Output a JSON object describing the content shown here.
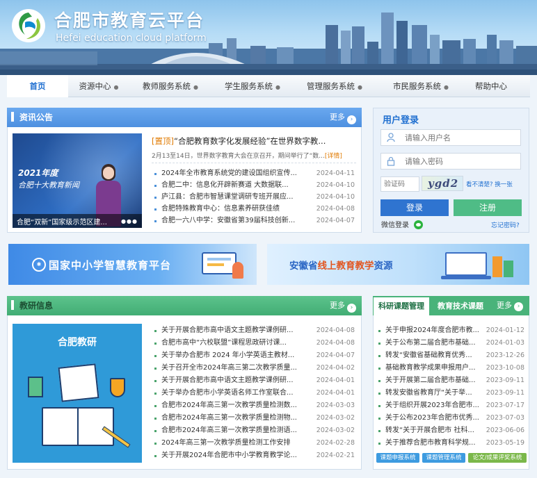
{
  "header": {
    "title": "合肥市教育云平台",
    "subtitle": "Hefei education cloud platform"
  },
  "nav": {
    "items": [
      {
        "label": "首页",
        "active": true,
        "dropdown": false
      },
      {
        "label": "资源中心",
        "active": false,
        "dropdown": true
      },
      {
        "label": "教师服务系统",
        "active": false,
        "dropdown": true
      },
      {
        "label": "学生服务系统",
        "active": false,
        "dropdown": true
      },
      {
        "label": "管理服务系统",
        "active": false,
        "dropdown": true
      },
      {
        "label": "市民服务系统",
        "active": false,
        "dropdown": true
      },
      {
        "label": "帮助中心",
        "active": false,
        "dropdown": false
      }
    ]
  },
  "news": {
    "title": "资讯公告",
    "more": "更多",
    "image_caption": "合肥“双新”国家级示范区建...",
    "image_badge": "2021年度",
    "image_headline": "合肥十大教育新闻",
    "featured": {
      "tag": "[置顶]",
      "title": "“合肥教育数字化发展经验”在世界数字教...",
      "summary": "2月13至14日，世界数字教育大会在京召开，期间举行了“数...",
      "detail_link": "[详情]"
    },
    "items": [
      {
        "title": "2024年全市教育系统党的建设国组织宣传...",
        "date": "2024-04-11"
      },
      {
        "title": "合肥二中：信息化开辟新赛道 大数据联...",
        "date": "2024-04-10"
      },
      {
        "title": "庐江县：合肥市智慧课堂调研专班开展应...",
        "date": "2024-04-10"
      },
      {
        "title": "合肥特殊教育中心：信息素养研获佳绩",
        "date": "2024-04-08"
      },
      {
        "title": "合肥一六八中学：安徽省第39届科技创新...",
        "date": "2024-04-07"
      }
    ]
  },
  "login": {
    "title": "用户登录",
    "username_placeholder": "请输入用户名",
    "password_placeholder": "请输入密码",
    "captcha_placeholder": "验证码",
    "captcha_text": "ygd2",
    "captcha_hint": "看不清楚?",
    "captcha_refresh": "换一张",
    "login_button": "登录",
    "register_button": "注册",
    "wechat_login": "微信登录",
    "forgot_password": "忘记密码?"
  },
  "banners": {
    "left_title": "国家中小学智慧教育平台",
    "right_title_part1": "安徽省",
    "right_title_part2": "线上教育教学",
    "right_title_part3": "资源"
  },
  "research": {
    "title": "教研信息",
    "more": "更多",
    "image_title": "合肥教研",
    "items": [
      {
        "title": "关于开展合肥市高中语文主题教学课例研...",
        "date": "2024-04-08"
      },
      {
        "title": "合肥市高中“六校联盟”课程思政研讨课...",
        "date": "2024-04-08"
      },
      {
        "title": "关于举办合肥市 2024 年小学英语主教材...",
        "date": "2024-04-07"
      },
      {
        "title": "关于召开全市2024年高三第二次教学质量...",
        "date": "2024-04-02"
      },
      {
        "title": "关于开展合肥市高中语文主题教学课例研...",
        "date": "2024-04-01"
      },
      {
        "title": "关于举办合肥市小学英语名师工作室联合...",
        "date": "2024-04-01"
      },
      {
        "title": "合肥市2024年高三第一次教学质量检测数...",
        "date": "2024-03-03"
      },
      {
        "title": "合肥市2024年高三第一次教学质量检测物...",
        "date": "2024-03-02"
      },
      {
        "title": "合肥市2024年高三第一次教学质量检测语...",
        "date": "2024-03-02"
      },
      {
        "title": "2024年高三第一次教学质量检测工作安排",
        "date": "2024-02-28"
      },
      {
        "title": "关于开展2024年合肥市中小学教育教学论...",
        "date": "2024-02-21"
      }
    ]
  },
  "projects": {
    "tabs": [
      "科研课题管理",
      "教育技术课题"
    ],
    "more": "更多",
    "items": [
      {
        "title": "关于申报2024年度合肥市教...",
        "date": "2024-01-12"
      },
      {
        "title": "关于公布第二届合肥市基础...",
        "date": "2024-01-03"
      },
      {
        "title": "转发“安徽省基础教育优秀...",
        "date": "2023-12-26"
      },
      {
        "title": "基础教育教学成果申报用户...",
        "date": "2023-10-08"
      },
      {
        "title": "关于开展第二届合肥市基础...",
        "date": "2023-09-11"
      },
      {
        "title": "转发安徽省教育厅“关于举...",
        "date": "2023-09-11"
      },
      {
        "title": "关于组织开展2023年合肥市...",
        "date": "2023-07-17"
      },
      {
        "title": "关于公布2023年合肥市优秀...",
        "date": "2023-07-03"
      },
      {
        "title": "转发“关于开展合肥市 社科...",
        "date": "2023-06-06"
      },
      {
        "title": "关于推荐合肥市教育科学规...",
        "date": "2023-05-19"
      }
    ],
    "bottom_buttons": [
      {
        "label": "课题申报系统",
        "color": "#3d9be0"
      },
      {
        "label": "课题管理系统",
        "color": "#3d9be0"
      },
      {
        "label": "论文/成果评奖系统",
        "color": "#7bb84a"
      }
    ]
  },
  "colors": {
    "blue_accent": "#1f6fd0",
    "blue_header": "#5b9ee8",
    "green_header": "#4dbb7d",
    "login_button": "#2f74d0",
    "register_button": "#4fbc86"
  }
}
